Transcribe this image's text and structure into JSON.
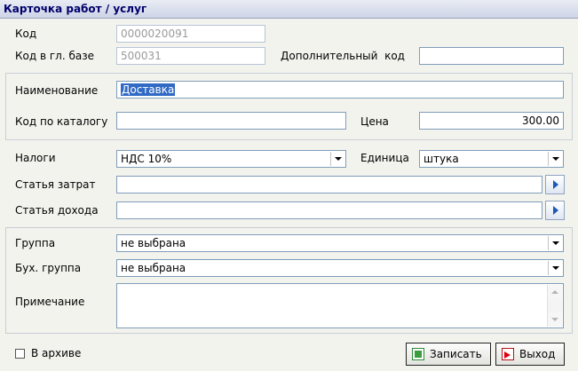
{
  "window": {
    "title": "Карточка работ / услуг"
  },
  "form": {
    "code": {
      "label": "Код",
      "value": "0000020091"
    },
    "main_base_code": {
      "label": "Код в гл. базе",
      "value": "500031"
    },
    "extra_code": {
      "label": "Дополнительный  код",
      "value": ""
    },
    "name": {
      "label": "Наименование",
      "value": "Доставка"
    },
    "catalog_code": {
      "label": "Код по каталогу",
      "value": ""
    },
    "price": {
      "label": "Цена",
      "value": "300.00"
    },
    "taxes": {
      "label": "Налоги",
      "value": "НДС 10%"
    },
    "unit": {
      "label": "Единица",
      "value": "штука"
    },
    "cost_item": {
      "label": "Статья затрат",
      "value": ""
    },
    "income_item": {
      "label": "Статья дохода",
      "value": ""
    },
    "group": {
      "label": "Группа",
      "value": "не выбрана"
    },
    "acc_group": {
      "label": "Бух. группа",
      "value": "не выбрана"
    },
    "note": {
      "label": "Примечание",
      "value": ""
    },
    "archive": {
      "label": "В архиве",
      "checked": false
    }
  },
  "buttons": {
    "save": "Записать",
    "exit": "Выход"
  },
  "icons": {
    "save": "save-icon",
    "exit": "exit-icon",
    "browse": "arrow-right-icon"
  },
  "colors": {
    "accent": "#316ac5",
    "title_text": "#00006b"
  }
}
